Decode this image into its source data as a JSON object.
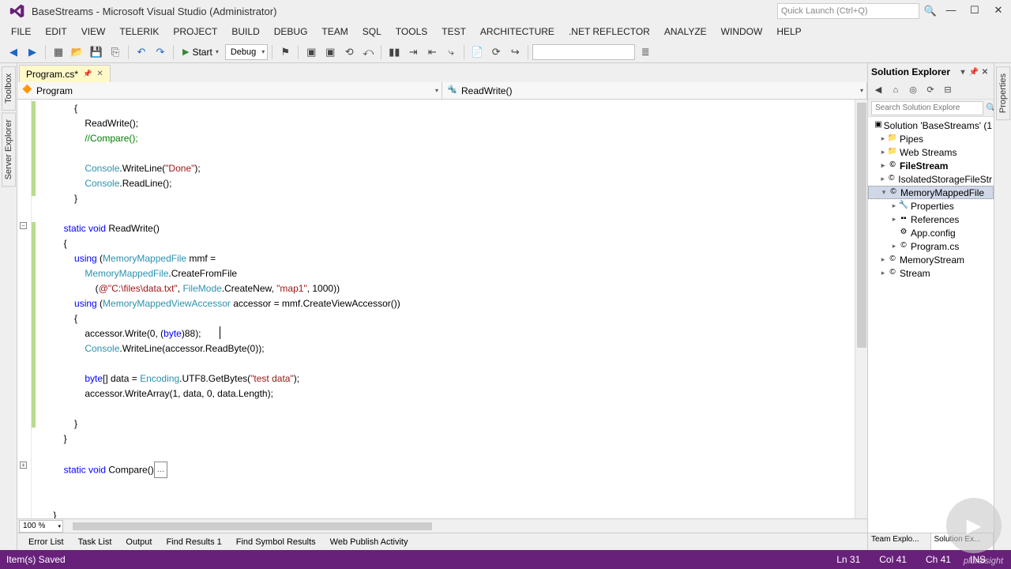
{
  "title": "BaseStreams - Microsoft Visual Studio (Administrator)",
  "quick_launch_placeholder": "Quick Launch (Ctrl+Q)",
  "menus": [
    "FILE",
    "EDIT",
    "VIEW",
    "TELERIK",
    "PROJECT",
    "BUILD",
    "DEBUG",
    "TEAM",
    "SQL",
    "TOOLS",
    "TEST",
    "ARCHITECTURE",
    ".NET REFLECTOR",
    "ANALYZE",
    "WINDOW",
    "HELP"
  ],
  "start_label": "Start",
  "config_dd": "Debug",
  "left_rail": [
    "Toolbox",
    "Server Explorer"
  ],
  "right_rail": [
    "Properties"
  ],
  "file_tab": "Program.cs*",
  "scope_dd": "Program",
  "member_dd": "ReadWrite()",
  "zoom": "100 %",
  "bottom_tabs": [
    "Error List",
    "Task List",
    "Output",
    "Find Results 1",
    "Find Symbol Results",
    "Web Publish Activity"
  ],
  "solution_explorer": {
    "title": "Solution Explorer",
    "search_placeholder": "Search Solution Explore",
    "tree": {
      "solution": "Solution 'BaseStreams' (1",
      "pipes": "Pipes",
      "webstreams": "Web Streams",
      "filestream": "FileStream",
      "isolated": "IsolatedStorageFileStr",
      "mmf": "MemoryMappedFile",
      "properties": "Properties",
      "references": "References",
      "appcfg": "App.config",
      "programcs": "Program.cs",
      "memstream": "MemoryStream",
      "stream": "Stream"
    },
    "bottom_tabs": [
      "Team Explo...",
      "Solution Ex..."
    ]
  },
  "status": {
    "left": "Item(s) Saved",
    "line": "Ln 31",
    "col": "Col 41",
    "ch": "Ch 41",
    "ins": "INS"
  },
  "brand": "pluralsight",
  "code": {
    "l1": "            {",
    "l2a": "                ReadWrite();",
    "l3a": "                ",
    "l3b": "//Compare();",
    "l4": "",
    "l5a": "                ",
    "l5b": "Console",
    "l5c": ".WriteLine(",
    "l5d": "\"Done\"",
    "l5e": ");",
    "l6a": "                ",
    "l6b": "Console",
    "l6c": ".ReadLine();",
    "l7": "            }",
    "l8": "",
    "l9a": "        ",
    "l9b": "static void",
    "l9c": " ReadWrite()",
    "l10": "        {",
    "l11a": "            ",
    "l11b": "using",
    "l11c": " (",
    "l11d": "MemoryMappedFile",
    "l11e": " mmf =",
    "l12a": "                ",
    "l12b": "MemoryMappedFile",
    "l12c": ".CreateFromFile",
    "l13a": "                    (",
    "l13b": "@\"C:\\files\\data.txt\"",
    "l13c": ", ",
    "l13d": "FileMode",
    "l13e": ".CreateNew, ",
    "l13f": "\"map1\"",
    "l13g": ", 1000))",
    "l14a": "            ",
    "l14b": "using",
    "l14c": " (",
    "l14d": "MemoryMappedViewAccessor",
    "l14e": " accessor = mmf.CreateViewAccessor())",
    "l15": "            {",
    "l16a": "                accessor.Write(0, (",
    "l16b": "byte",
    "l16c": ")88);       ",
    "l17a": "                ",
    "l17b": "Console",
    "l17c": ".WriteLine(accessor.ReadByte(0));",
    "l18": "",
    "l19a": "                ",
    "l19b": "byte",
    "l19c": "[] data = ",
    "l19d": "Encoding",
    "l19e": ".UTF8.GetBytes(",
    "l19f": "\"test data\"",
    "l19g": ");",
    "l20": "                accessor.WriteArray(1, data, 0, data.Length);",
    "l21": "",
    "l22": "            }",
    "l23": "        }",
    "l24": "",
    "l25a": "        ",
    "l25b": "static void",
    "l25c": " Compare()",
    "l25d": "...",
    "l26": "",
    "l27": "",
    "l28": "    }"
  }
}
